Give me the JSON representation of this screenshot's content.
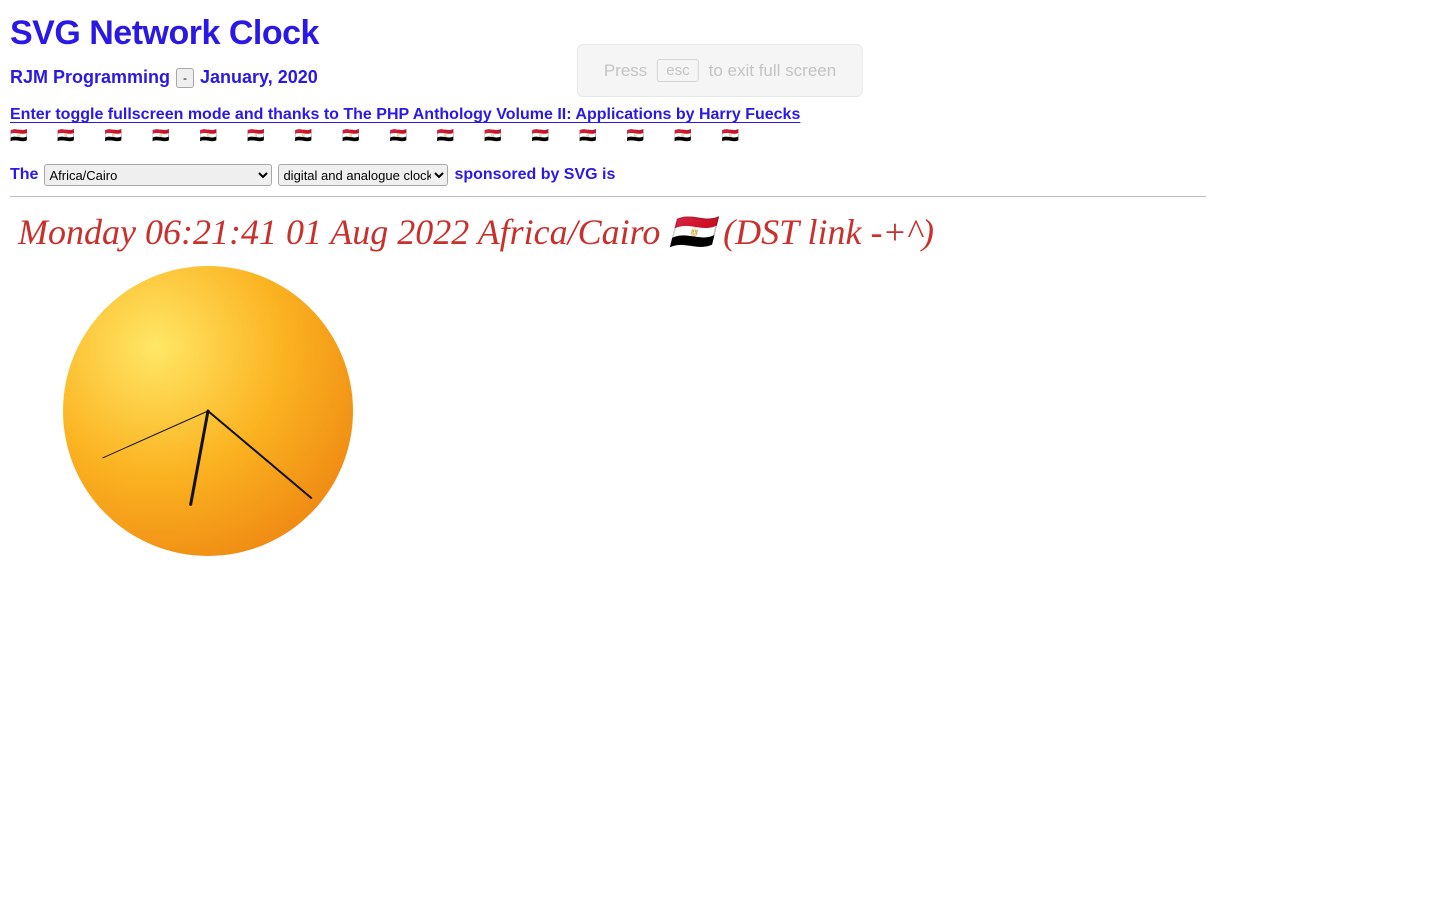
{
  "header": {
    "title": "SVG Network Clock",
    "subtitle_prefix": "RJM Programming",
    "toggle_button_label": "-",
    "subtitle_suffix": "January, 2020",
    "credits_text": "Enter toggle fullscreen mode and thanks to The PHP Anthology Volume II: Applications by Harry Fuecks",
    "flag_glyph": "🇪🇬",
    "flag_count": 16
  },
  "controls": {
    "prefix": "The",
    "timezone_selected": "Africa/Cairo",
    "mode_selected": "digital and analogue clock",
    "suffix": "sponsored by SVG is"
  },
  "digital_clock": {
    "weekday": "Monday",
    "time": "06:21:41",
    "date": "01 Aug 2022",
    "timezone_label": "Africa/Cairo",
    "flag": "🇪🇬",
    "dst_suffix": "(DST link -+^)"
  },
  "analogue_clock": {
    "hours": 6,
    "minutes": 21,
    "seconds": 41,
    "face_gradient_inner": "#ffe766",
    "face_gradient_mid": "#fbb321",
    "face_gradient_outer": "#ef8a13"
  },
  "overlay": {
    "press_label": "Press",
    "esc_key": "esc",
    "exit_label": "to exit full screen"
  }
}
